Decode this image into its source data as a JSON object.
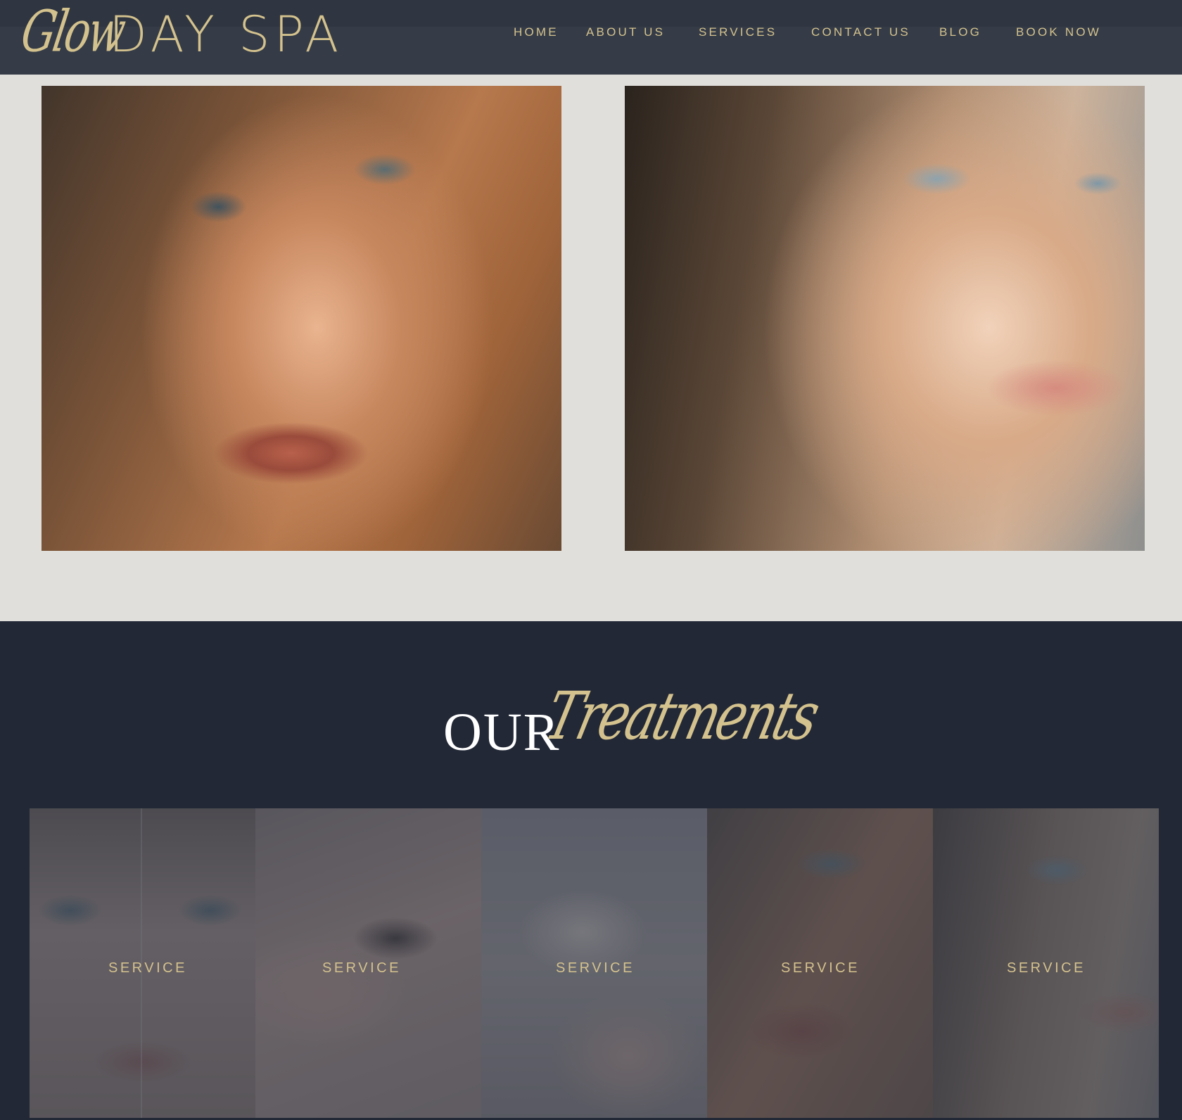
{
  "header": {
    "logo_script": "Glow",
    "logo_main": "DAY SPA",
    "nav": [
      {
        "label": "HOME"
      },
      {
        "label": "ABOUT US"
      },
      {
        "label": "SERVICES"
      },
      {
        "label": "CONTACT US"
      },
      {
        "label": "BLOG"
      },
      {
        "label": "BOOK NOW"
      }
    ]
  },
  "treatments": {
    "heading_our": "OUR",
    "heading_script": "Treatments",
    "cards": [
      {
        "label": "SERVICE"
      },
      {
        "label": "SERVICE"
      },
      {
        "label": "SERVICE"
      },
      {
        "label": "SERVICE"
      },
      {
        "label": "SERVICE"
      }
    ]
  },
  "colors": {
    "gold_accent": "#d4c28e",
    "header_bg": "#2f3742",
    "page_bg": "#e1dfdc",
    "treatments_bg": "#222836"
  }
}
